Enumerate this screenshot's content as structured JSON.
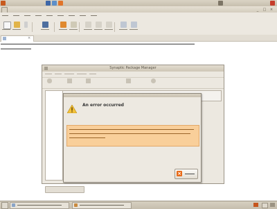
{
  "top_panel": {
    "menus": [
      {
        "label": ""
      },
      {
        "label": ""
      },
      {
        "label": ""
      }
    ],
    "clock": ""
  },
  "editor_window": {
    "title": "",
    "menubar": [
      "",
      "",
      "",
      "",
      "",
      "",
      "",
      "",
      ""
    ],
    "toolbar_buttons": [
      {
        "icon": "new-document-icon",
        "label": ""
      },
      {
        "icon": "open-folder-icon",
        "label": ""
      },
      {
        "icon": "save-icon",
        "label": ""
      },
      {
        "icon": "print-icon",
        "label": ""
      },
      {
        "icon": "undo-icon",
        "label": ""
      },
      {
        "icon": "redo-icon",
        "label": ""
      },
      {
        "icon": "cut-icon",
        "label": ""
      },
      {
        "icon": "copy-icon",
        "label": ""
      },
      {
        "icon": "paste-icon",
        "label": ""
      },
      {
        "icon": "find-icon",
        "label": ""
      },
      {
        "icon": "replace-icon",
        "label": ""
      }
    ],
    "tab_label": "",
    "text_lines": [
      "",
      ""
    ]
  },
  "synaptic_window": {
    "title": "Synaptic Package Manager",
    "toolbar": [
      {
        "icon": "reload-icon",
        "label": ""
      },
      {
        "icon": "mark-upgrades-icon",
        "label": ""
      },
      {
        "icon": "apply-icon",
        "label": ""
      },
      {
        "icon": "properties-icon",
        "label": ""
      },
      {
        "icon": "search-icon",
        "label": ""
      }
    ],
    "status_button": ""
  },
  "error_dialog": {
    "heading": "An error occurred",
    "detail": "",
    "error_text": [
      "",
      "",
      ""
    ],
    "close_label": ""
  },
  "taskbar": {
    "tasks": [
      {
        "label": ""
      },
      {
        "label": ""
      }
    ]
  },
  "colors": {
    "error_box_bg": "#f9cf9a",
    "warning_yellow": "#f3c23a",
    "close_icon": "#e86a18"
  }
}
